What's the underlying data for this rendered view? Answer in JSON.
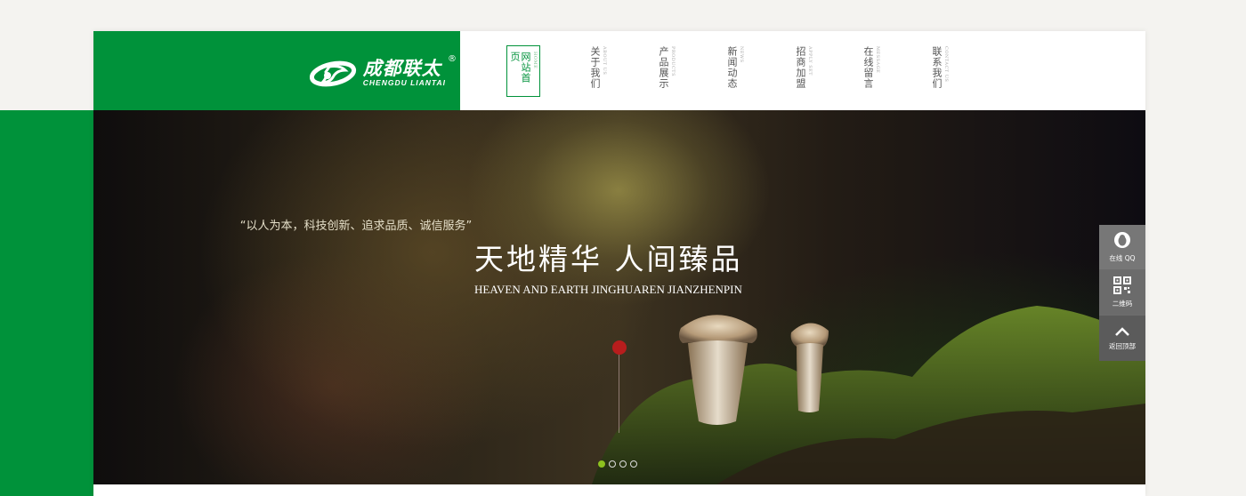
{
  "logo": {
    "name_cn": "成都联太",
    "name_en": "CHENGDU LIANTAI",
    "reg": "®",
    "icon": "company-logo-icon"
  },
  "nav": [
    {
      "cn": "网站首页",
      "en": "HOME",
      "active": true
    },
    {
      "cn": "关于我们",
      "en": "ABOUT US",
      "active": false
    },
    {
      "cn": "产品展示",
      "en": "PRODUCTS",
      "active": false
    },
    {
      "cn": "新闻动态",
      "en": "NEWS",
      "active": false
    },
    {
      "cn": "招商加盟",
      "en": "APPLY SET",
      "active": false
    },
    {
      "cn": "在线留言",
      "en": "MESSAGE",
      "active": false
    },
    {
      "cn": "联系我们",
      "en": "CONTACT US",
      "active": false
    }
  ],
  "banner": {
    "slogan": "“以人为本，科技创新、追求品质、诚信服务”",
    "headline": "天地精华  人间臻品",
    "headline_en": "HEAVEN AND EARTH JINGHUAREN JIANZHENPIN",
    "slides_total": 4,
    "active_slide": 1
  },
  "side_tools": [
    {
      "label": "在线 QQ",
      "icon": "qq-penguin-icon"
    },
    {
      "label": "二维码",
      "icon": "qr-code-icon"
    },
    {
      "label": "返回顶部",
      "icon": "chevron-up-icon"
    }
  ],
  "colors": {
    "brand_green": "#00923a",
    "pin_red": "#b71d1d",
    "active_dot": "#8dc21f"
  }
}
